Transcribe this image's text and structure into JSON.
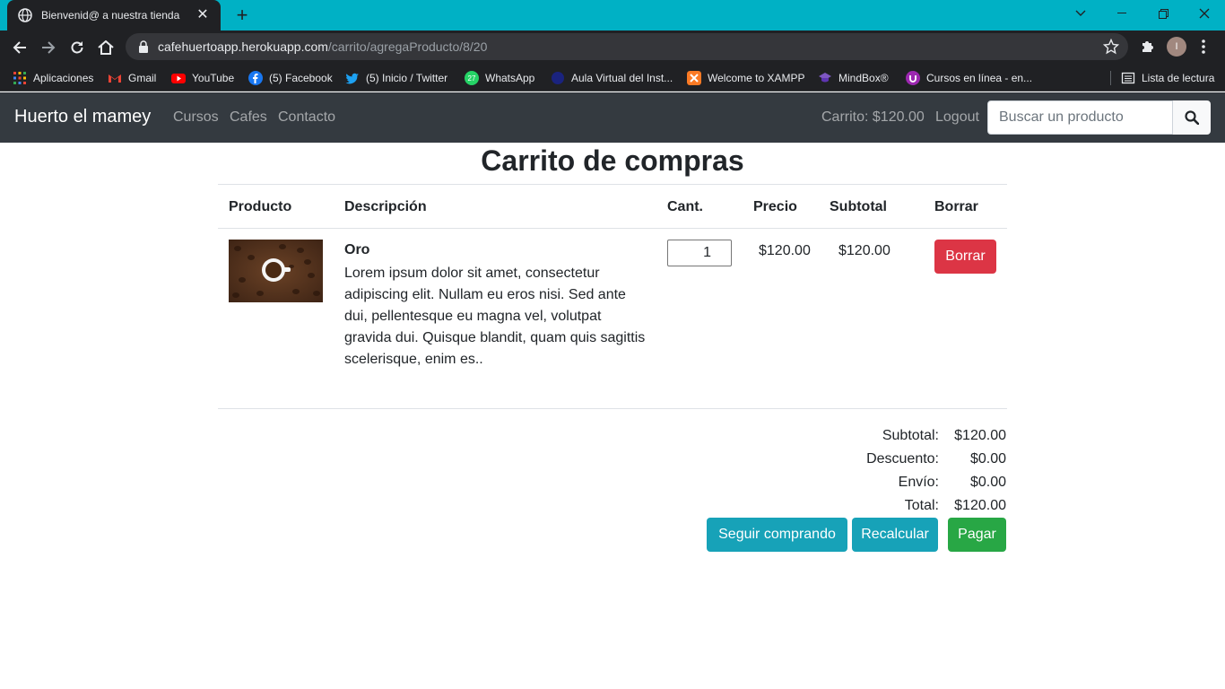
{
  "browser": {
    "tab_title": "Bienvenid@ a nuestra tienda",
    "url_host": "cafehuertoapp.herokuapp.com",
    "url_path": "/carrito/agregaProducto/8/20",
    "profile_initial": "I",
    "bookmarks": [
      {
        "label": "Aplicaciones",
        "icon": "apps-grid-icon"
      },
      {
        "label": "Gmail",
        "icon": "gmail-icon"
      },
      {
        "label": "YouTube",
        "icon": "youtube-icon"
      },
      {
        "label": "(5) Facebook",
        "icon": "facebook-icon"
      },
      {
        "label": "(5) Inicio / Twitter",
        "icon": "twitter-icon"
      },
      {
        "label": "WhatsApp",
        "icon": "whatsapp-icon"
      },
      {
        "label": "Aula Virtual del Inst...",
        "icon": "aula-icon"
      },
      {
        "label": "Welcome to XAMPP",
        "icon": "xampp-icon"
      },
      {
        "label": "MindBox®",
        "icon": "mindbox-icon"
      },
      {
        "label": "Cursos en línea - en...",
        "icon": "cursos-icon"
      }
    ],
    "reading_list": "Lista de lectura",
    "whatsapp_badge": "27"
  },
  "navbar": {
    "brand": "Huerto el mamey",
    "links": [
      "Cursos",
      "Cafes",
      "Contacto"
    ],
    "cart": "Carrito: $120.00",
    "logout": "Logout",
    "search_placeholder": "Buscar un producto"
  },
  "cart": {
    "title": "Carrito de compras",
    "headers": [
      "Producto",
      "Descripción",
      "Cant.",
      "Precio",
      "Subtotal",
      "Borrar"
    ],
    "items": [
      {
        "name": "Oro",
        "description": "Lorem ipsum dolor sit amet, consectetur adipiscing elit. Nullam eu eros nisi. Sed ante dui, pellentesque eu magna vel, volutpat gravida dui. Quisque blandit, quam quis sagittis scelerisque, enim es..",
        "qty": "1",
        "price": "$120.00",
        "subtotal": "$120.00",
        "delete_label": "Borrar"
      }
    ],
    "summary": {
      "subtotal_label": "Subtotal:",
      "subtotal": "$120.00",
      "discount_label": "Descuento:",
      "discount": "$0.00",
      "shipping_label": "Envío:",
      "shipping": "$0.00",
      "total_label": "Total:",
      "total": "$120.00"
    },
    "buttons": {
      "continue": "Seguir comprando",
      "recalc": "Recalcular",
      "pay": "Pagar"
    }
  },
  "colors": {
    "tabstrip": "#00b1c5",
    "navbar": "#343a40",
    "danger": "#dc3545",
    "info": "#17a2b8",
    "success": "#28a745"
  }
}
